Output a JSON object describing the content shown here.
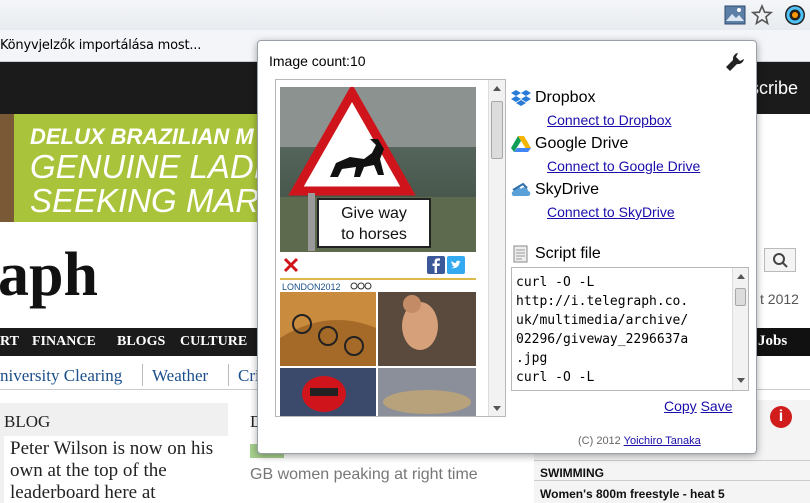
{
  "bookmarks": {
    "import_label": "Könyvjelzők importálása most..."
  },
  "page": {
    "subscribe": "scribe",
    "ad": {
      "line1": "DELUX BRAZILIAN M",
      "line2": "GENUINE LADIES",
      "line3": "SEEKING MARRIA"
    },
    "logo": "aph",
    "date": "t 2012",
    "nav": [
      "RT",
      "FINANCE",
      "BLOGS",
      "CULTURE"
    ],
    "nav_jobs": "Jobs",
    "subnav": [
      "niversity Clearing",
      "Weather",
      "Cri"
    ],
    "blog_title": "BLOG",
    "blog_text": "Peter Wilson is now on his own at the top of the leaderboard here at",
    "mid_letter": "D",
    "mid_text": "GB women peaking at right time",
    "section_head": "SWIMMING",
    "section_sub": "Women's 800m freestyle - heat 5",
    "info_badge": "i"
  },
  "popup": {
    "image_count": "Image count:10",
    "sign_text_1": "Give way",
    "sign_text_2": "to horses",
    "olympic_label": "LONDON2012",
    "services": [
      {
        "name": "Dropbox",
        "link": "Connect to Dropbox",
        "icon": "dropbox-icon"
      },
      {
        "name": "Google Drive",
        "link": "Connect to Google Drive",
        "icon": "google-drive-icon"
      },
      {
        "name": "SkyDrive",
        "link": "Connect to SkyDrive",
        "icon": "skydrive-icon"
      }
    ],
    "script_title": "Script file",
    "script_text": "curl -O -L\nhttp://i.telegraph.co.\nuk/multimedia/archive/\n02296/giveway_2296637a\n.jpg\ncurl -O -L\nhttp://i.telegraph.co.",
    "copy_label": "Copy",
    "save_label": "Save",
    "footer_prefix": "(C) 2012",
    "footer_author": "Yoichiro Tanaka"
  }
}
